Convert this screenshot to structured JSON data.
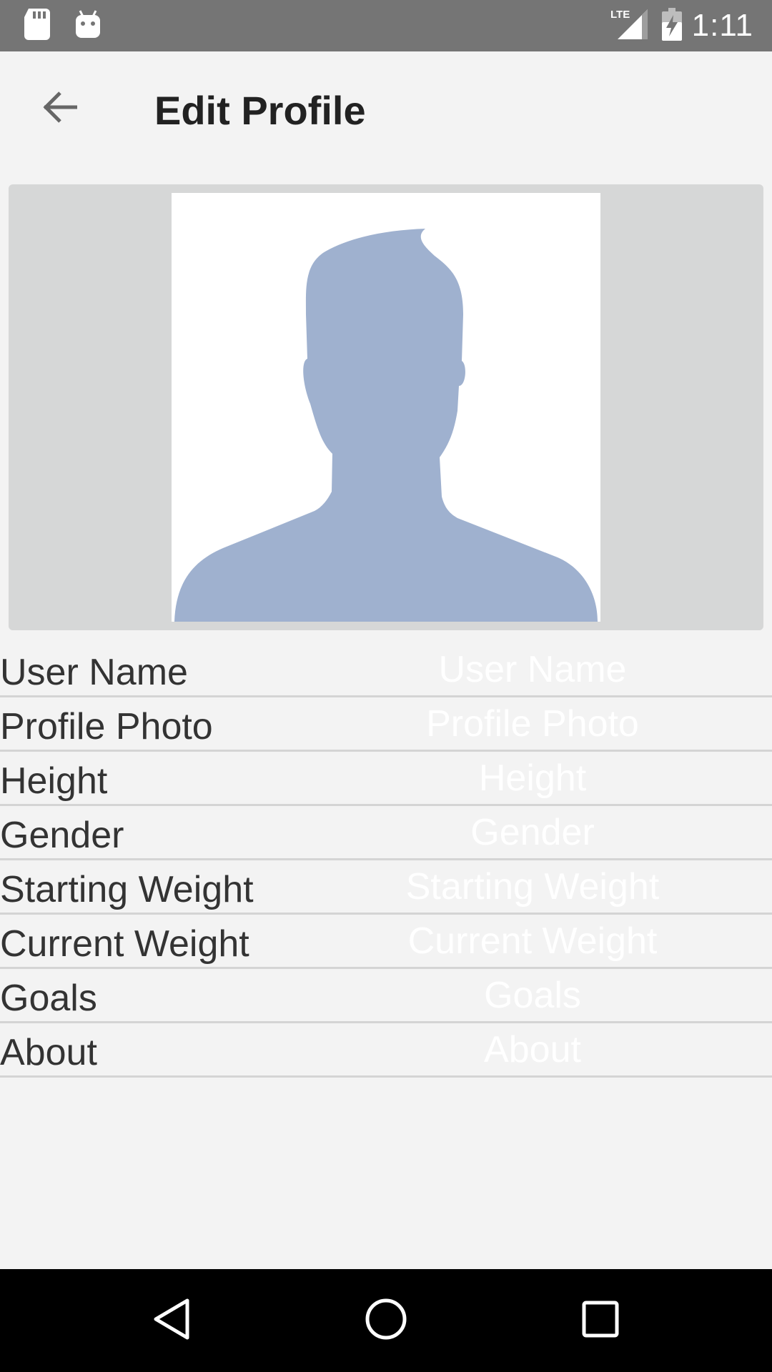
{
  "status_bar": {
    "time": "1:11",
    "network": "LTE",
    "icons": [
      "sd-card-icon",
      "android-debug-icon",
      "lte-signal-icon",
      "battery-charging-icon"
    ]
  },
  "toolbar": {
    "title": "Edit Profile",
    "back_icon": "arrow-back-icon"
  },
  "profile_photo": {
    "placeholder_icon": "default-avatar-silhouette",
    "silhouette_color": "#9fb1cf"
  },
  "fields": [
    {
      "label": "User Name",
      "placeholder": "User Name",
      "value": ""
    },
    {
      "label": "Profile Photo",
      "placeholder": "Profile Photo",
      "value": ""
    },
    {
      "label": "Height",
      "placeholder": "Height",
      "value": ""
    },
    {
      "label": "Gender",
      "placeholder": "Gender",
      "value": ""
    },
    {
      "label": "Starting Weight",
      "placeholder": "Starting Weight",
      "value": ""
    },
    {
      "label": "Current Weight",
      "placeholder": "Current Weight",
      "value": ""
    },
    {
      "label": "Goals",
      "placeholder": "Goals",
      "value": ""
    },
    {
      "label": "About",
      "placeholder": "About",
      "value": ""
    }
  ],
  "nav_bar": {
    "icons": [
      "back-triangle-icon",
      "home-circle-icon",
      "recents-square-icon"
    ]
  },
  "colors": {
    "status_bar": "#757575",
    "background": "#f3f3f3",
    "photo_panel": "#d6d7d7",
    "divider": "#d4d4d4",
    "nav_bar": "#000000"
  }
}
